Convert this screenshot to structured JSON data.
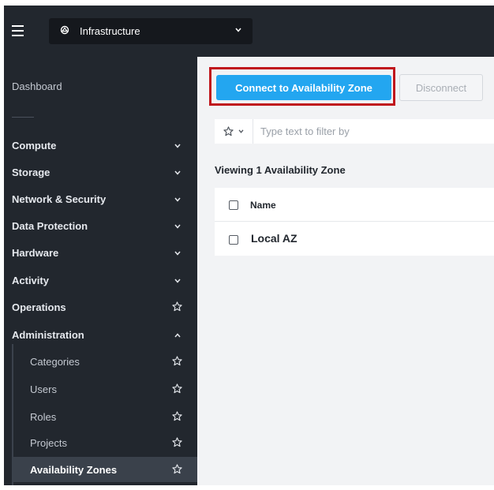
{
  "header": {
    "app_name": "Infrastructure"
  },
  "sidebar": {
    "dashboard": "Dashboard",
    "sections": [
      {
        "label": "Compute",
        "state": "collapsed"
      },
      {
        "label": "Storage",
        "state": "collapsed"
      },
      {
        "label": "Network & Security",
        "state": "collapsed"
      },
      {
        "label": "Data Protection",
        "state": "collapsed"
      },
      {
        "label": "Hardware",
        "state": "collapsed"
      },
      {
        "label": "Activity",
        "state": "collapsed"
      },
      {
        "label": "Operations",
        "state": "favorite"
      },
      {
        "label": "Administration",
        "state": "expanded"
      }
    ],
    "admin_items": [
      {
        "label": "Categories"
      },
      {
        "label": "Users"
      },
      {
        "label": "Roles"
      },
      {
        "label": "Projects"
      },
      {
        "label": "Availability Zones",
        "active": true
      }
    ]
  },
  "toolbar": {
    "connect_label": "Connect to Availability Zone",
    "disconnect_label": "Disconnect"
  },
  "filter": {
    "placeholder": "Type text to filter by"
  },
  "summary": {
    "viewing": "Viewing 1 Availability Zone"
  },
  "table": {
    "columns": [
      "Name"
    ],
    "rows": [
      {
        "name": "Local AZ"
      }
    ]
  },
  "colors": {
    "primary_button": "#23a6f0",
    "highlight_box": "#c0151c",
    "sidebar_bg": "#22272e"
  }
}
